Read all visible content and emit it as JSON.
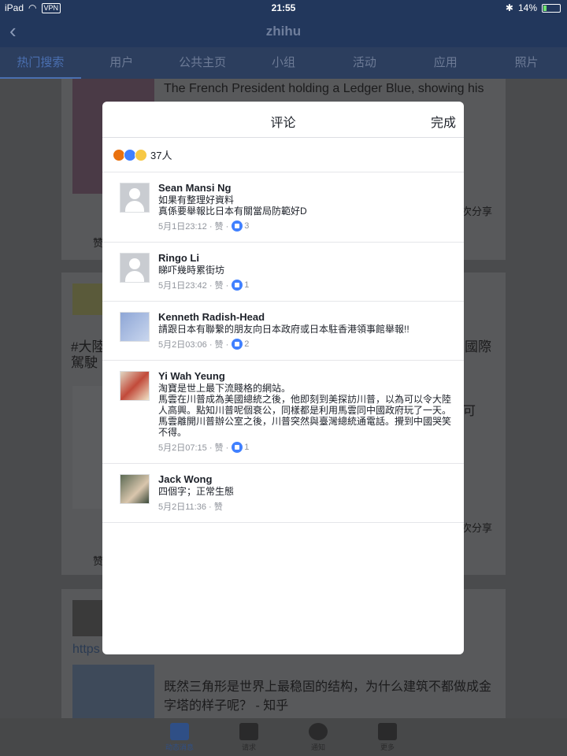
{
  "status": {
    "device": "iPad",
    "vpn": "VPN",
    "time": "21:55",
    "battery": "14%"
  },
  "nav": {
    "title": "zhihu"
  },
  "tabs": [
    "热门搜索",
    "用户",
    "公共主页",
    "小组",
    "活动",
    "应用",
    "照片"
  ],
  "feed": {
    "card1_title": "The French President holding a Ledger Blue, showing his",
    "card1_share": "次分享",
    "card1_like": "赞",
    "card2_title": "#大陸",
    "card2_suffix": "國際",
    "card2_line2": "駕駛",
    "card2_share": "次分享",
    "card2_like": "赞",
    "card2_mid": "可",
    "card3_link": "https",
    "card3_title": "既然三角形是世界上最稳固的结构，为什么建筑不都做成金字塔的样子呢？ - 知乎"
  },
  "bottom_tabs": [
    "动态消息",
    "请求",
    "通知",
    "更多"
  ],
  "modal": {
    "title": "评论",
    "done": "完成",
    "reaction_count": "37人",
    "comments": [
      {
        "name": "Sean Mansi Ng",
        "body": "如果有整理好資料\n真係要舉報比日本有關當局防範好D",
        "time": "5月1日23:12 · 赞 ·",
        "likes": "3"
      },
      {
        "name": "Ringo Li",
        "body": "睇吓幾時累街坊",
        "time": "5月1日23:42 · 赞 ·",
        "likes": "1"
      },
      {
        "name": "Kenneth Radish-Head",
        "body": "請跟日本有聯繫的朋友向日本政府或日本駐香港領事館舉報!!",
        "time": "5月2日03:06 · 赞 ·",
        "likes": "2"
      },
      {
        "name": "Yi Wah Yeung",
        "body": "淘寶是世上最下流賤格的網站。\n馬雲在川普成為美國總統之後，他即刻到美探訪川普，以為可以令大陸人高興。點知川普呢個衰公，同樣都是利用馬雲同中國政府玩了一天。馬雲離開川普辦公室之後，川普突然與臺灣總統通電話。攪到中國哭笑不得。",
        "time": "5月2日07:15 · 赞 ·",
        "likes": "1"
      },
      {
        "name": "Jack Wong",
        "body": "四個字；正常生態",
        "time": "5月2日11:36 · 赞",
        "likes": ""
      }
    ]
  }
}
